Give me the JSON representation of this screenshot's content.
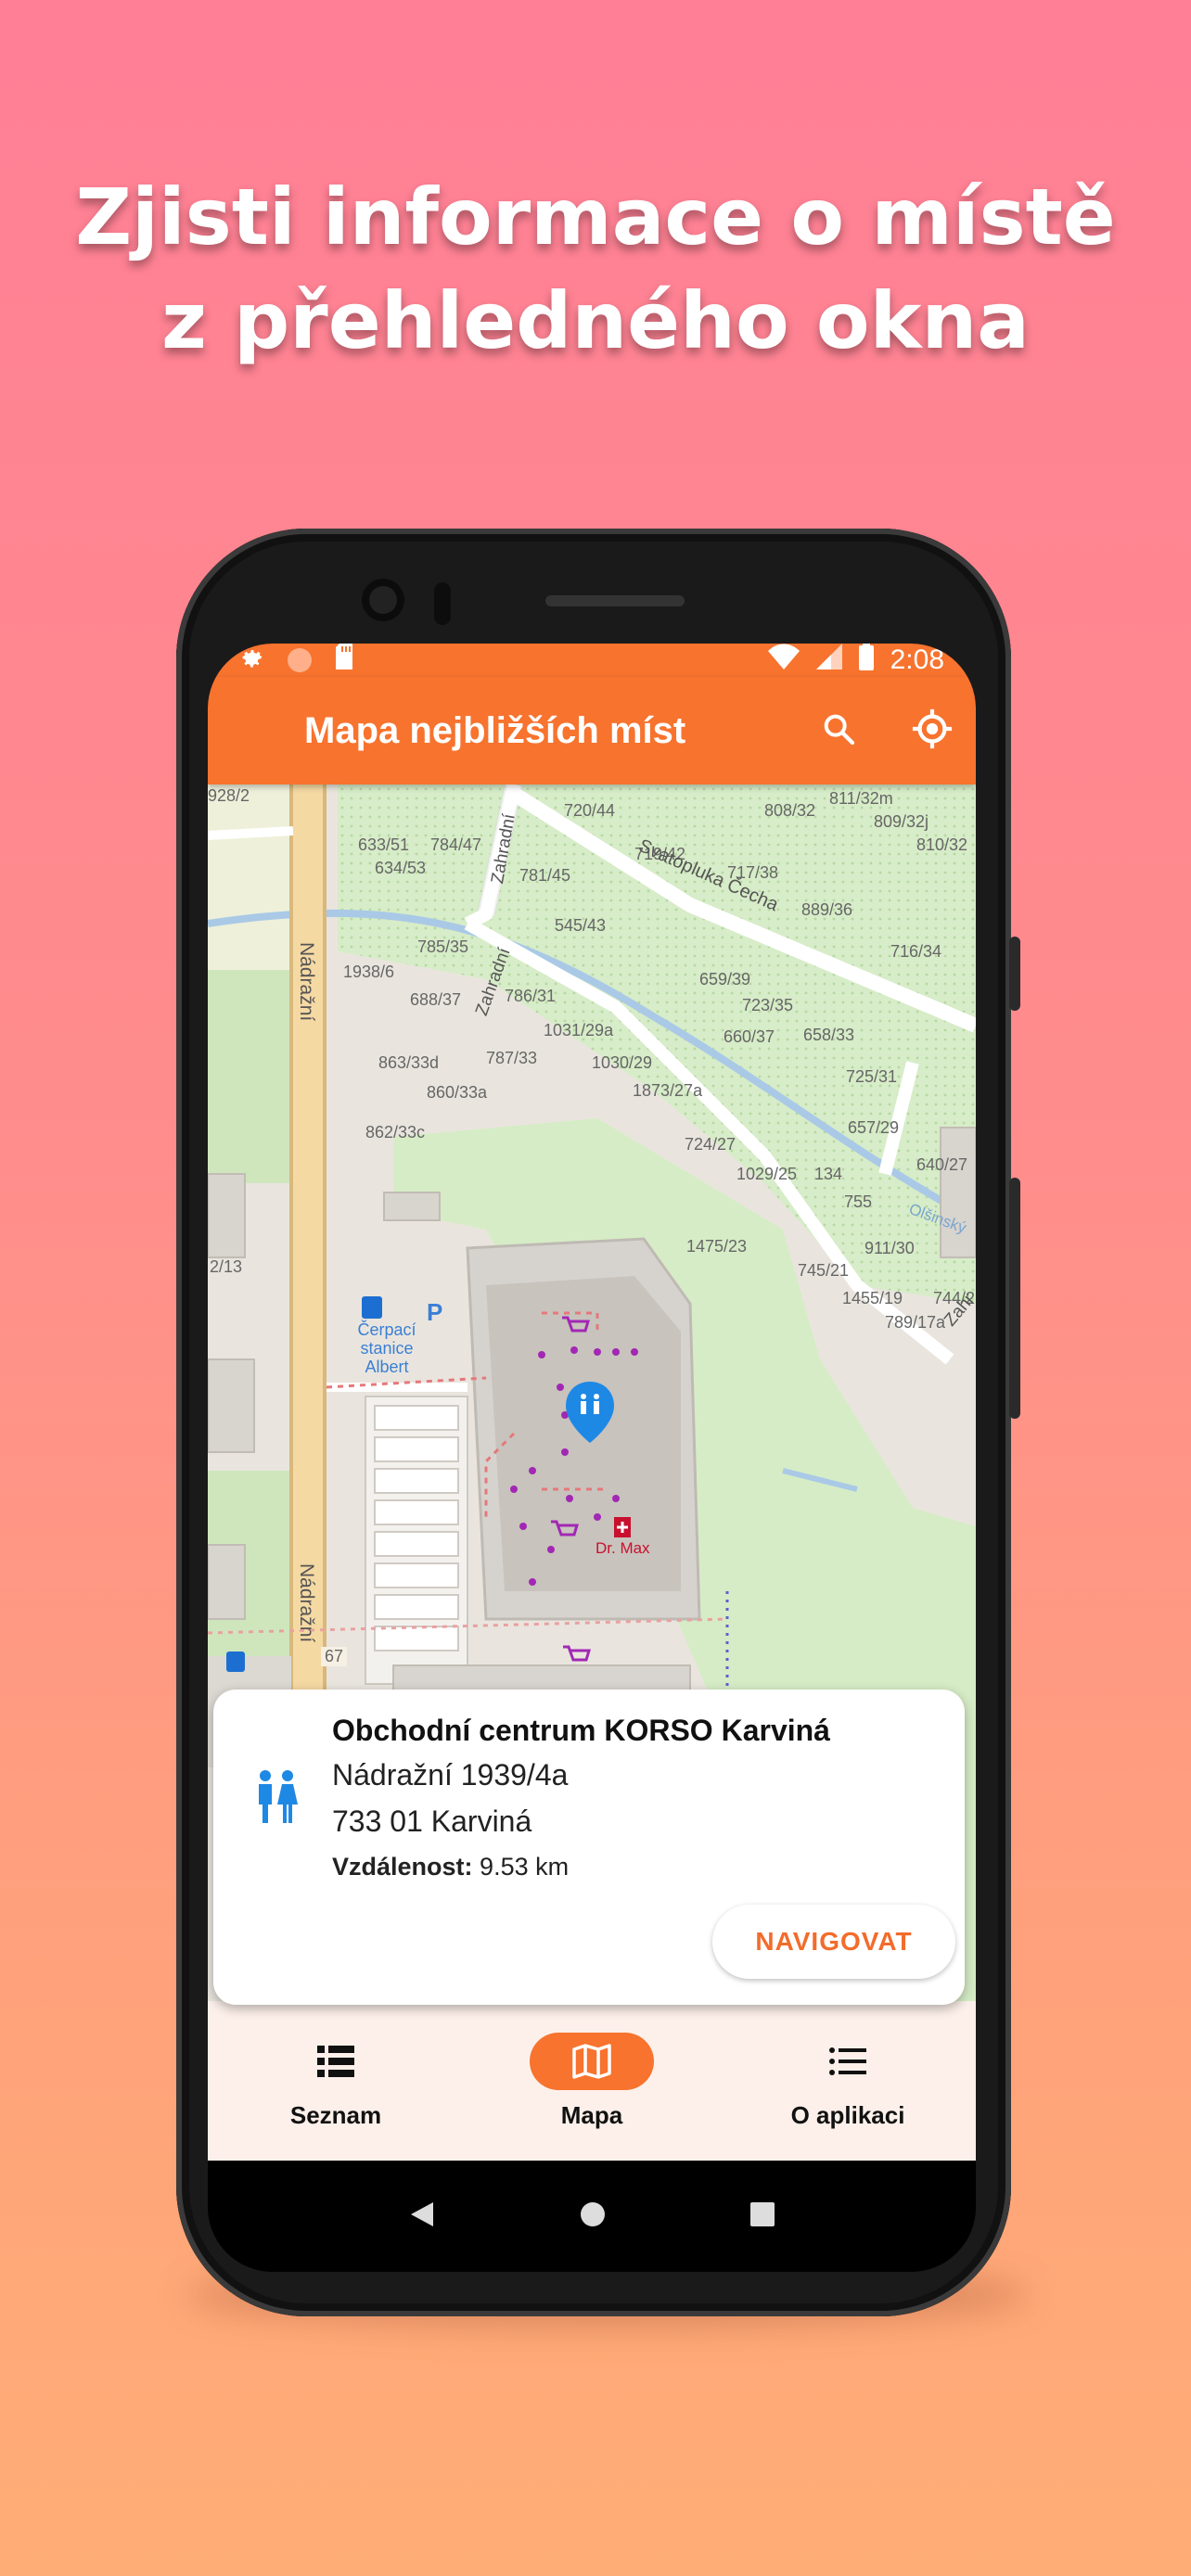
{
  "headline": {
    "line1": "Zjisti informace o místě",
    "line2": "z přehledného okna"
  },
  "status_bar": {
    "time": "2:08",
    "icons": [
      "gear-icon",
      "circle-icon",
      "sd-card-icon",
      "wifi-icon",
      "signal-icon",
      "battery-icon"
    ]
  },
  "app_bar": {
    "title": "Mapa nejbližších míst",
    "actions": [
      "search-icon",
      "my-location-icon"
    ]
  },
  "map": {
    "street_labels": [
      "Nádražní",
      "Nádražní",
      "Zahradní",
      "Zahradní",
      "Svatopluka Čecha",
      "Olšinský",
      "Zahr"
    ],
    "house_numbers": [
      "928/2",
      "633/51",
      "784/47",
      "634/53",
      "720/44",
      "808/32",
      "811/32m",
      "809/32j",
      "810/32",
      "719/42",
      "717/38",
      "781/45",
      "889/36",
      "785/35",
      "545/43",
      "716/34",
      "1938/6",
      "659/39",
      "688/37",
      "786/31",
      "723/35",
      "1031/29a",
      "660/37",
      "658/33",
      "863/33d",
      "787/33",
      "1030/29",
      "725/31",
      "860/33a",
      "1873/27a",
      "657/29",
      "862/33c",
      "724/27",
      "640/27",
      "1029/25",
      "134",
      "755",
      "1475/23",
      "911/30",
      "745/21",
      "2/13",
      "1455/19",
      "744/2",
      "789/17a",
      "67"
    ],
    "poi_labels": [
      "Čerpací stanice Albert",
      "Dr. Max"
    ],
    "parking_label": "P"
  },
  "place_card": {
    "name": "Obchodní centrum KORSO Karviná",
    "street": "Nádražní 1939/4a",
    "city": "733 01 Karviná",
    "distance_label": "Vzdálenost:",
    "distance_value": "9.53 km",
    "navigate_button": "NAVIGOVAT"
  },
  "bottom_nav": {
    "items": [
      {
        "label": "Seznam",
        "icon": "list-icon",
        "active": false
      },
      {
        "label": "Mapa",
        "icon": "map-icon",
        "active": true
      },
      {
        "label": "O aplikaci",
        "icon": "about-list-icon",
        "active": false
      }
    ]
  },
  "colors": {
    "accent": "#f7732e",
    "button_text": "#f36c2b",
    "nav_background": "#fdf0ea",
    "poi_blue": "#1e88e5",
    "poi_purple": "#a228b4"
  }
}
